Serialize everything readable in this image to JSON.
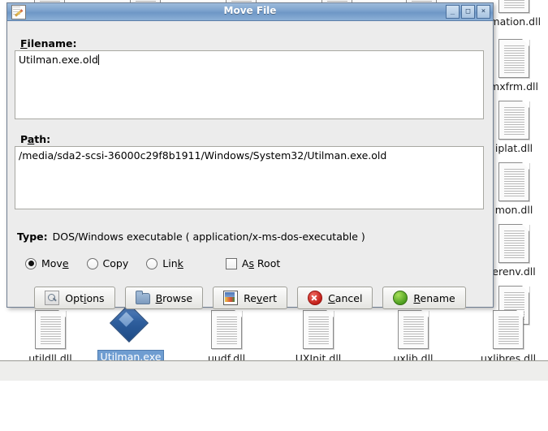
{
  "dialog": {
    "title": "Move File",
    "window_icon": "pencil-document-icon",
    "buttons": {
      "minimize": "_",
      "maximize": "□",
      "close": "×"
    },
    "filename": {
      "label_pre": "F",
      "label_accel": "i",
      "label_post": "lename:",
      "label_full": "Filename:",
      "value": "Utilman.exe.old"
    },
    "path": {
      "label_pre": "P",
      "label_accel": "a",
      "label_post": "th:",
      "label_full": "Path:",
      "value": "/media/sda2-scsi-36000c29f8b1911/Windows/System32/Utilman.exe.old"
    },
    "type": {
      "label": "Type:",
      "value": "DOS/Windows executable ( application/x-ms-dos-executable )"
    },
    "options": [
      {
        "name": "move",
        "label_pre": "Mov",
        "label_accel": "e",
        "label_post": "",
        "label_full": "Move",
        "control": "radio",
        "checked": true
      },
      {
        "name": "copy",
        "label_pre": "Copy",
        "label_accel": "",
        "label_post": "",
        "label_full": "Copy",
        "control": "radio",
        "checked": false
      },
      {
        "name": "link",
        "label_pre": "Lin",
        "label_accel": "k",
        "label_post": "",
        "label_full": "Link",
        "control": "radio",
        "checked": false
      },
      {
        "name": "as-root",
        "label_pre": "A",
        "label_accel": "s",
        "label_post": " Root",
        "label_full": "As Root",
        "control": "checkbox",
        "checked": false
      }
    ],
    "actions": [
      {
        "name": "options",
        "icon": "magnifier-options-icon",
        "label_pre": "Opt",
        "label_accel": "i",
        "label_post": "ons",
        "label_full": "Options"
      },
      {
        "name": "browse",
        "icon": "folder-icon",
        "label_pre": "",
        "label_accel": "B",
        "label_post": "rowse",
        "label_full": "Browse"
      },
      {
        "name": "revert",
        "icon": "revert-image-icon",
        "label_pre": "Re",
        "label_accel": "v",
        "label_post": "ert",
        "label_full": "Revert"
      },
      {
        "name": "cancel",
        "icon": "red-x-circle-icon",
        "label_pre": "",
        "label_accel": "C",
        "label_post": "ancel",
        "label_full": "Cancel"
      },
      {
        "name": "rename",
        "icon": "green-circle-icon",
        "label_pre": "",
        "label_accel": "R",
        "label_post": "ename",
        "label_full": "Rename"
      }
    ]
  },
  "file_manager": {
    "icons": [
      {
        "name": "utildll",
        "label": "utildll.dll",
        "icon": "document-icon",
        "selected": false
      },
      {
        "name": "utilman",
        "label": "Utilman.exe",
        "icon": "gem-icon",
        "selected": true
      },
      {
        "name": "uudf",
        "label": "uudf.dll",
        "icon": "document-icon",
        "selected": false
      },
      {
        "name": "uxinit",
        "label": "UXInit.dll",
        "icon": "document-icon",
        "selected": false
      },
      {
        "name": "uxlib",
        "label": "uxlib.dll",
        "icon": "document-icon",
        "selected": false
      },
      {
        "name": "uxlibres",
        "label": "uxlibres.dll",
        "icon": "document-icon",
        "selected": false
      }
    ],
    "side_icons": [
      {
        "name": "imation",
        "label": "imation.dll",
        "icon": "document-icon"
      },
      {
        "name": "mxfrm",
        "label": "mxfrm.dll",
        "icon": "document-icon"
      },
      {
        "name": "iplat",
        "label": "iplat.dll",
        "icon": "document-icon"
      },
      {
        "name": "mon",
        "label": "mon.dll",
        "icon": "document-icon"
      },
      {
        "name": "erenv",
        "label": "erenv.dll",
        "icon": "document-icon"
      }
    ]
  },
  "colors": {
    "titlebar": "#7fa4ce",
    "selection": "#6f9dd1",
    "dialog_bg": "#ececec",
    "cancel_red": "#c3201a",
    "rename_green": "#4a9c1e"
  }
}
